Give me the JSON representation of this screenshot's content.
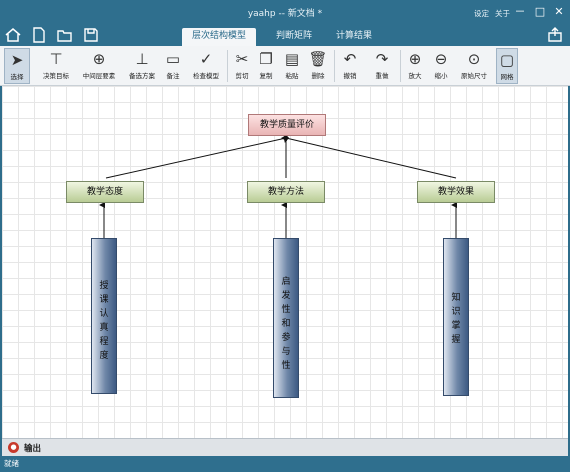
{
  "window": {
    "title": "yaahp -- 新文档 *",
    "links": [
      "设定",
      "关于"
    ],
    "controls": {
      "minimize": "－",
      "maximize": "□",
      "close": "✕"
    }
  },
  "quick_access": [
    "home-icon",
    "new-document-icon",
    "open-icon",
    "save-icon"
  ],
  "tabs": [
    {
      "label": "层次结构模型",
      "active": true
    },
    {
      "label": "判断矩阵",
      "active": false
    },
    {
      "label": "计算结果",
      "active": false
    }
  ],
  "toolbar": {
    "select": "选择",
    "decision_goal": "决策目标",
    "middle_factor": "中间层要素",
    "alternative": "备选方案",
    "note": "备注",
    "check_model": "检查模型",
    "cut": "剪切",
    "copy": "复制",
    "paste": "粘贴",
    "delete": "删除",
    "undo": "撤销",
    "redo": "重做",
    "zoom_in": "放大",
    "zoom_out": "缩小",
    "original_size": "原始尺寸",
    "grid": "网格"
  },
  "model": {
    "goal": "教学质量评价",
    "criteria": [
      "教学态度",
      "教学方法",
      "教学效果"
    ],
    "alternatives": [
      "授课认真程度",
      "启发性和参与性",
      "知识掌握"
    ]
  },
  "output_panel": {
    "label": "输出",
    "icon": "output-icon"
  },
  "status": "就绪",
  "colors": {
    "titlebar": "#2f6f8e",
    "goal_fill": "#f4c9c9",
    "criterion_fill": "#c8d9a8",
    "alternative_fill": "#4d6a92"
  }
}
